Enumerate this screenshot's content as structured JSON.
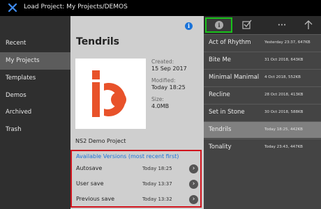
{
  "header": {
    "title": "Load Project: My Projects/DEMOS"
  },
  "sidebar": {
    "items": [
      {
        "label": "Recent"
      },
      {
        "label": "My Projects"
      },
      {
        "label": "Templates"
      },
      {
        "label": "Demos"
      },
      {
        "label": "Archived"
      },
      {
        "label": "Trash"
      }
    ],
    "active": "My Projects"
  },
  "project": {
    "name": "Tendrils",
    "created_label": "Created:",
    "created": "15 Sep 2017",
    "modified_label": "Modified:",
    "modified": "Today 18:25",
    "size_label": "Size:",
    "size": "4.0MB",
    "description": "NS2 Demo Project",
    "info_icon": "i"
  },
  "versions": {
    "heading": "Available Versions (most recent first)",
    "items": [
      {
        "name": "Autosave",
        "time": "Today 18:25"
      },
      {
        "name": "User save",
        "time": "Today 13:37"
      },
      {
        "name": "Previous save",
        "time": "Today 13:32"
      }
    ]
  },
  "toolbar": {
    "info_glyph": "i",
    "more_glyph": "•••"
  },
  "files": {
    "items": [
      {
        "name": "Act of Rhythm",
        "info": "Yesterday 23:37, 647KB"
      },
      {
        "name": "Bite Me",
        "info": "31 Oct 2018, 643KB"
      },
      {
        "name": "Minimal Manimal",
        "info": "4 Oct 2018, 552KB"
      },
      {
        "name": "Recline",
        "info": "28 Oct 2018, 413KB"
      },
      {
        "name": "Set in Stone",
        "info": "30 Oct 2018, 588KB"
      },
      {
        "name": "Tendrils",
        "info": "Today 18:25, 442KB"
      },
      {
        "name": "Tonality",
        "info": "Today 23:43, 447KB"
      }
    ],
    "active": "Tendrils"
  },
  "colors": {
    "accent_blue": "#1a73d9",
    "highlight_red": "#d1141d",
    "selection_green": "#19c31a",
    "logo_orange": "#e8522a"
  }
}
